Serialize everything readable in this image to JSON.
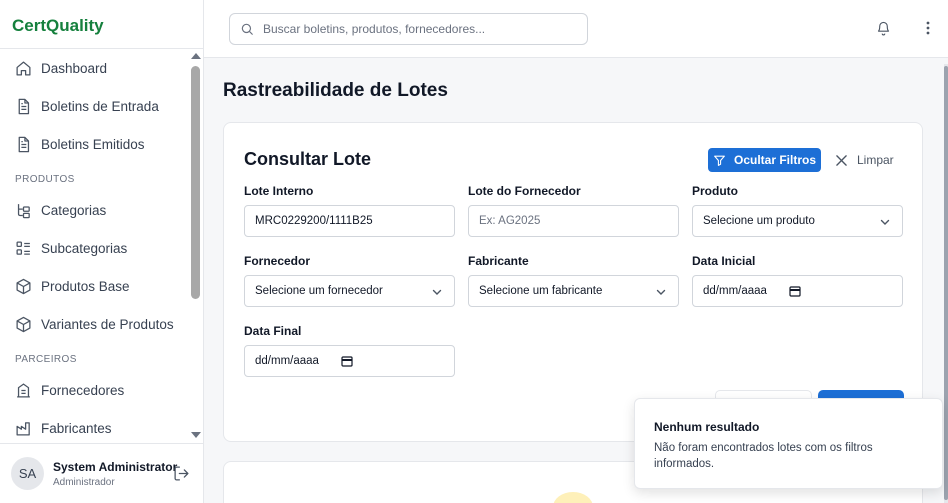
{
  "app": {
    "brand": "CertQuality",
    "brand_color": "#15803d",
    "accent": "#1d6fd6"
  },
  "sidebar": {
    "items_top": [
      {
        "label": "Dashboard",
        "icon": "home-icon"
      },
      {
        "label": "Boletins de Entrada",
        "icon": "document-icon"
      },
      {
        "label": "Boletins Emitidos",
        "icon": "document-icon"
      }
    ],
    "section_produtos": "PRODUTOS",
    "items_produtos": [
      {
        "label": "Categorias",
        "icon": "category-tree-icon"
      },
      {
        "label": "Subcategorias",
        "icon": "list-icon"
      },
      {
        "label": "Produtos Base",
        "icon": "box-icon"
      },
      {
        "label": "Variantes de Produtos",
        "icon": "box-icon"
      }
    ],
    "section_parceiros": "PARCEIROS",
    "items_parceiros": [
      {
        "label": "Fornecedores",
        "icon": "building-icon"
      },
      {
        "label": "Fabricantes",
        "icon": "factory-icon"
      }
    ]
  },
  "user": {
    "initials": "SA",
    "name": "System Administrator",
    "role": "Administrador"
  },
  "topbar": {
    "search_placeholder": "Buscar boletins, produtos, fornecedores..."
  },
  "page": {
    "title": "Rastreabilidade de Lotes"
  },
  "filters": {
    "title": "Consultar Lote",
    "hide_button": "Ocultar Filtros",
    "clear_button": "Limpar",
    "lote_interno": {
      "label": "Lote Interno",
      "value": "MRC0229200/1111B25"
    },
    "lote_fornecedor": {
      "label": "Lote do Fornecedor",
      "placeholder": "Ex: AG2025"
    },
    "produto": {
      "label": "Produto",
      "value": "Selecione um produto"
    },
    "fornecedor": {
      "label": "Fornecedor",
      "value": "Selecione um fornecedor"
    },
    "fabricante": {
      "label": "Fabricante",
      "value": "Selecione um fabricante"
    },
    "data_inicial": {
      "label": "Data Inicial",
      "value": "dd/mm/aaaa"
    },
    "data_final": {
      "label": "Data Final",
      "value": "dd/mm/aaaa"
    }
  },
  "toast": {
    "title": "Nenhum resultado",
    "message": "Não foram encontrados lotes com os filtros informados."
  }
}
